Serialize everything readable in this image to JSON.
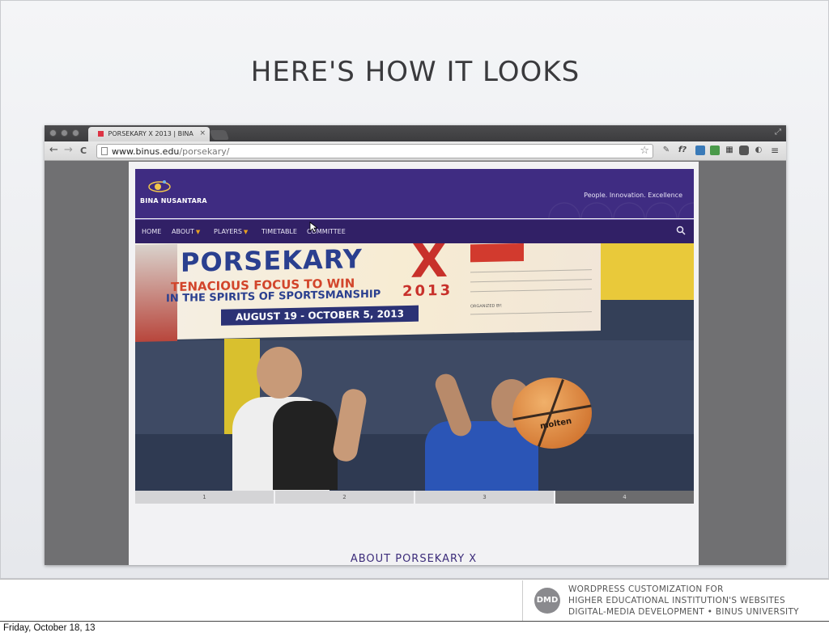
{
  "slide": {
    "title": "HERE'S HOW IT LOOKS"
  },
  "browser": {
    "tab_title": "PORSEKARY X 2013 | BINA",
    "tab_close": "×",
    "url_host": "www.binus.edu",
    "url_path": "/porsekary/",
    "nav_back": "←",
    "nav_forward": "→",
    "nav_reload": "C",
    "star": "☆",
    "menu": "≡",
    "ext_f": "f?"
  },
  "site": {
    "logo_text": "BINA NUSANTARA",
    "tagline": "People. Innovation. Excellence",
    "nav": [
      {
        "label": "HOME"
      },
      {
        "label": "ABOUT",
        "caret": "▼"
      },
      {
        "label": "PLAYERS",
        "caret": "▼"
      },
      {
        "label": "TIMETABLE"
      },
      {
        "label": "COMMITTEE"
      }
    ],
    "banner": {
      "title": "PORSEKARY",
      "x": "X",
      "sub1": "TENACIOUS FOCUS TO WIN",
      "sub2": "IN THE SPIRITS OF SPORTSMANSHIP",
      "year": "2013",
      "dates": "AUGUST 19 - OCTOBER 5, 2013",
      "organized": "ORGANIZED BY:",
      "ball_brand": "molten"
    },
    "pager": [
      "1",
      "2",
      "3",
      "4"
    ],
    "pager_active": "4",
    "about_heading": "ABOUT PORSEKARY X"
  },
  "footer": {
    "logo": "DMD",
    "line1": "WordPress Customization for",
    "line2": "Higher Educational Institution's Websites",
    "line3": "Digital-Media Development • BINUS University",
    "date": "Friday, October 18, 13"
  },
  "colors": {
    "header_purple": "#3f2c82",
    "nav_purple": "#312066",
    "banner_blue": "#2a3f8f",
    "banner_red": "#c8312b"
  }
}
